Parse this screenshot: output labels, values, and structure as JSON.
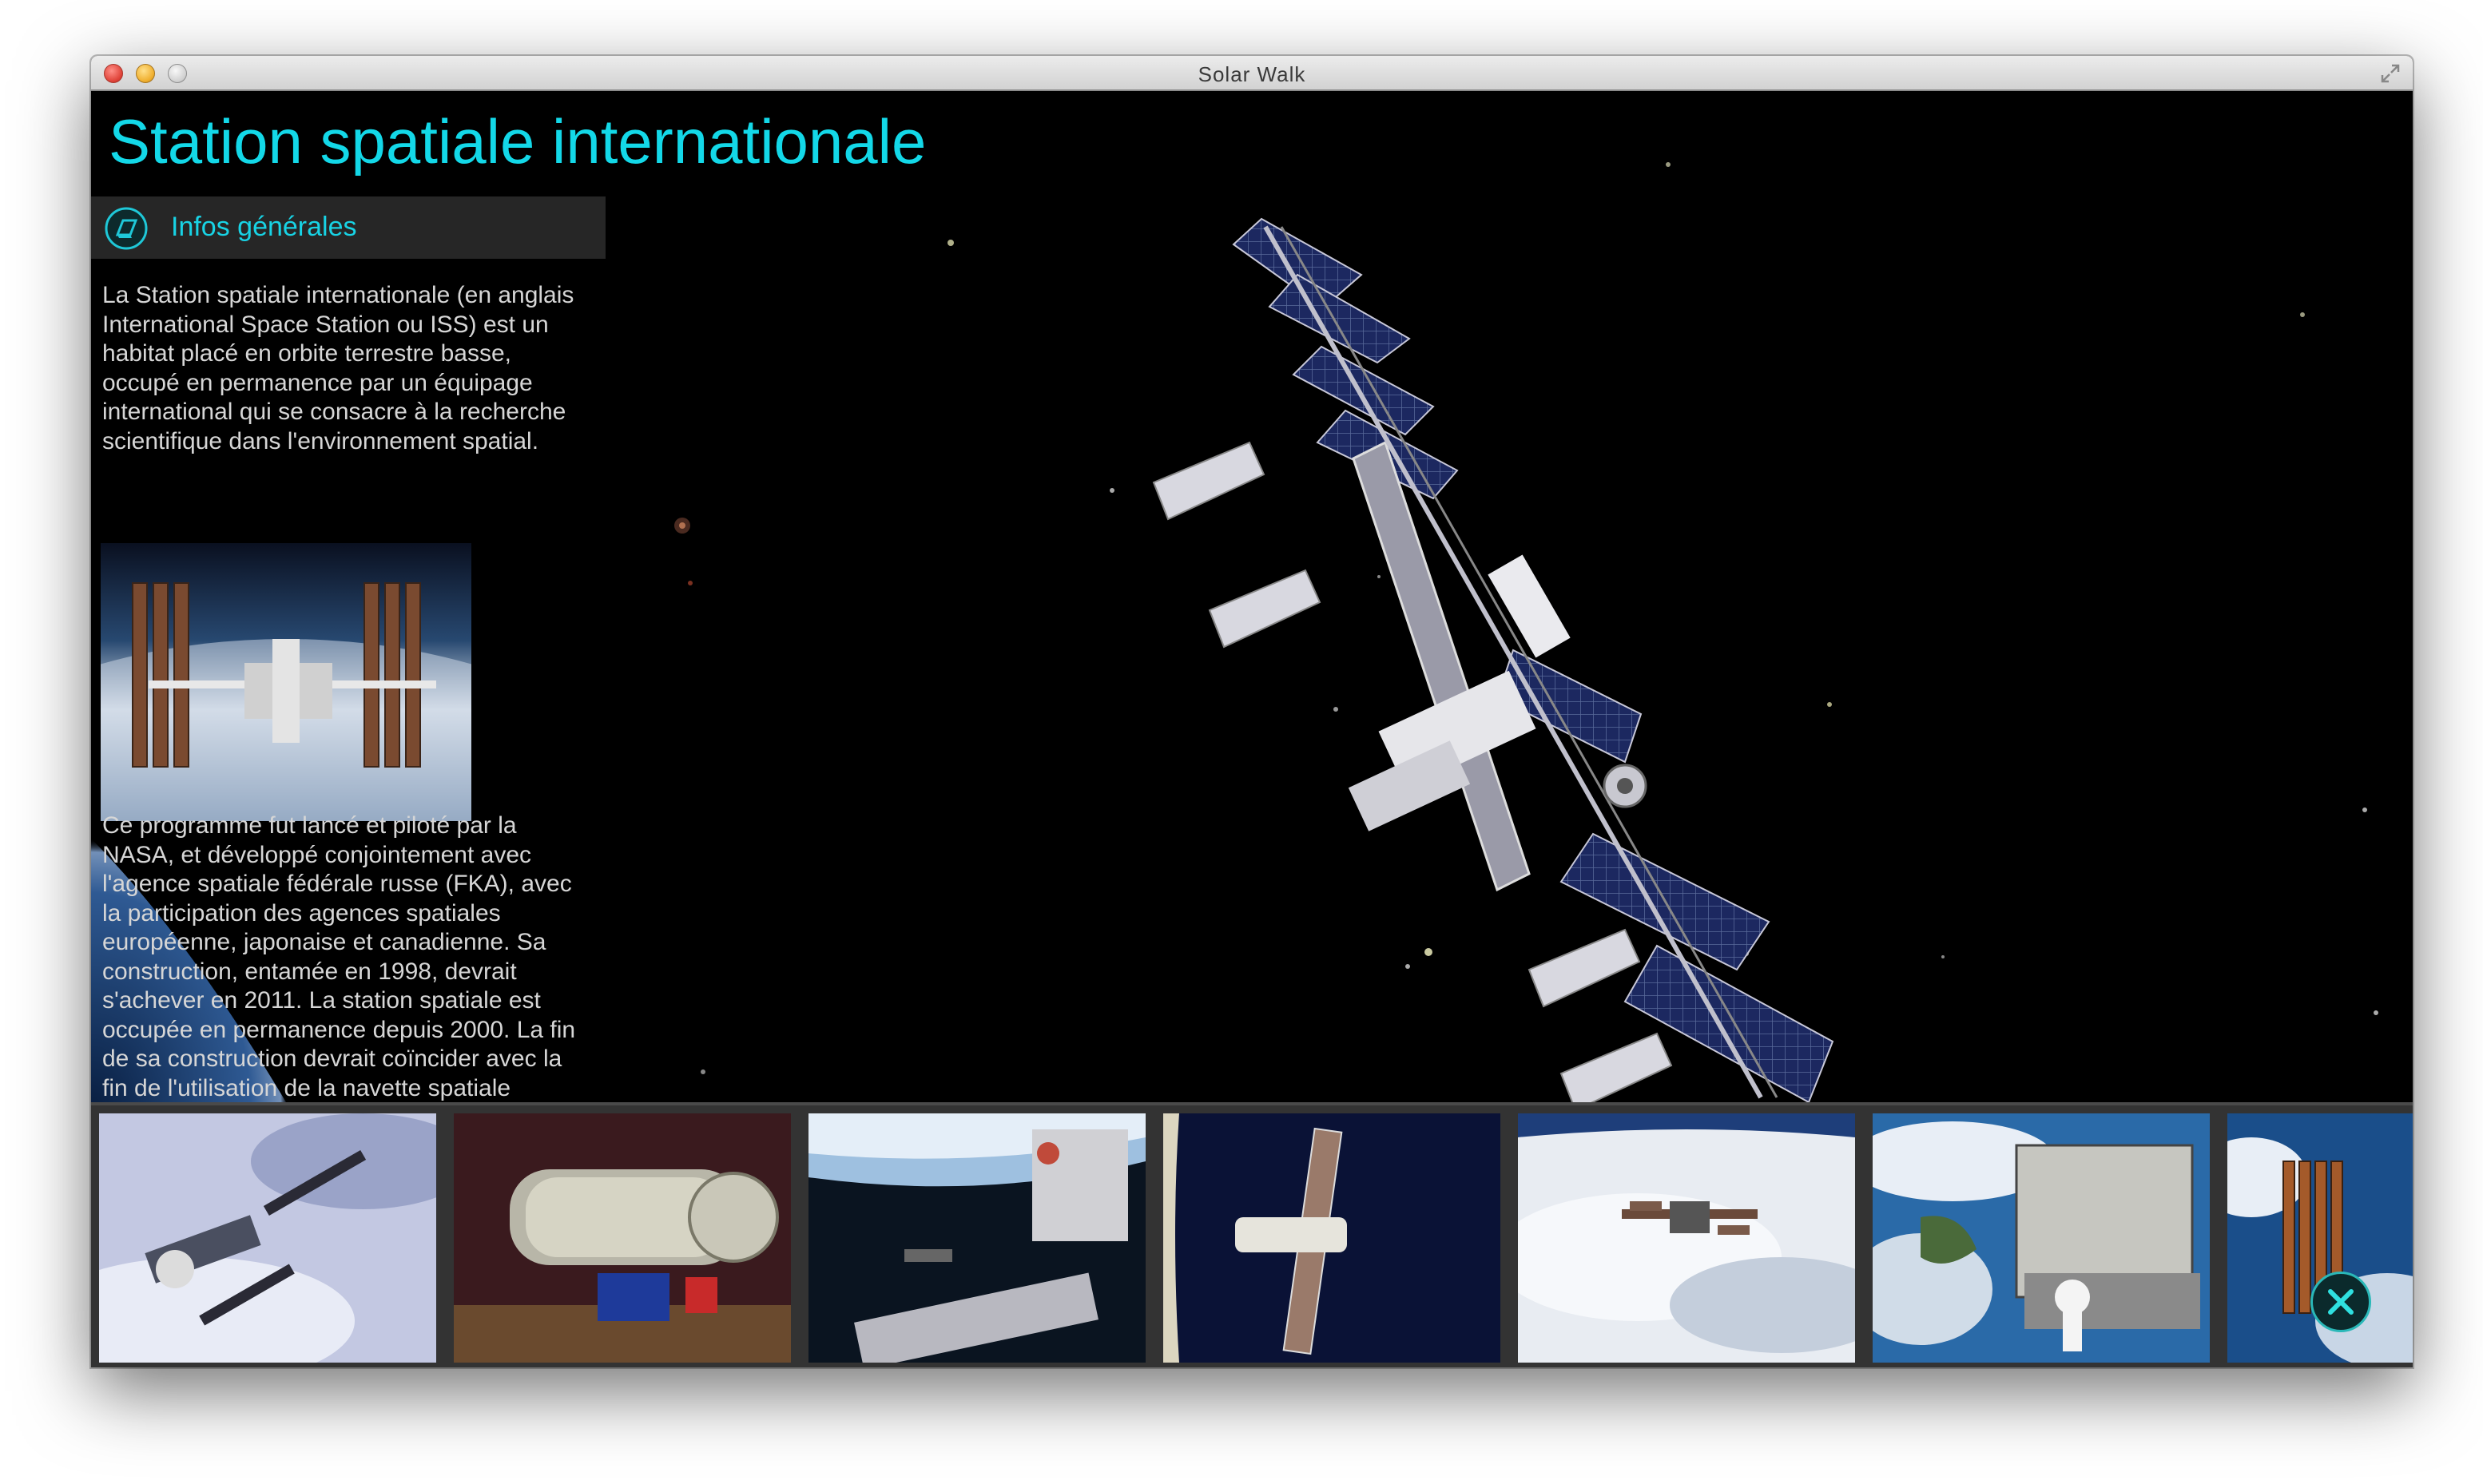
{
  "window": {
    "title": "Solar Walk"
  },
  "panel": {
    "title": "Station spatiale internationale",
    "section_label": "Infos générales",
    "section_icon": "book-icon",
    "paragraph1": "La Station spatiale internationale (en anglais International Space Station ou ISS) est un habitat placé en orbite terrestre basse, occupé en permanence par un équipage international qui se consacre à la recherche scientifique dans l'environnement spatial.",
    "paragraph2": "Ce programme fut lancé et piloté par la NASA, et développé conjointement avec l'agence spatiale fédérale russe (FKA), avec la participation des agences spatiales européenne, japonaise et canadienne. Sa construction, entamée en 1998, devrait s'achever en 2011. La station spatiale est occupée en permanence depuis 2000. La fin de sa construction devrait coïncider avec la fin de l'utilisation de la navette spatiale américaine."
  },
  "gallery": {
    "count": 7,
    "close_icon": "close-icon"
  },
  "colors": {
    "accent": "#13d8e8",
    "background": "#000000",
    "strip": "#333333"
  }
}
